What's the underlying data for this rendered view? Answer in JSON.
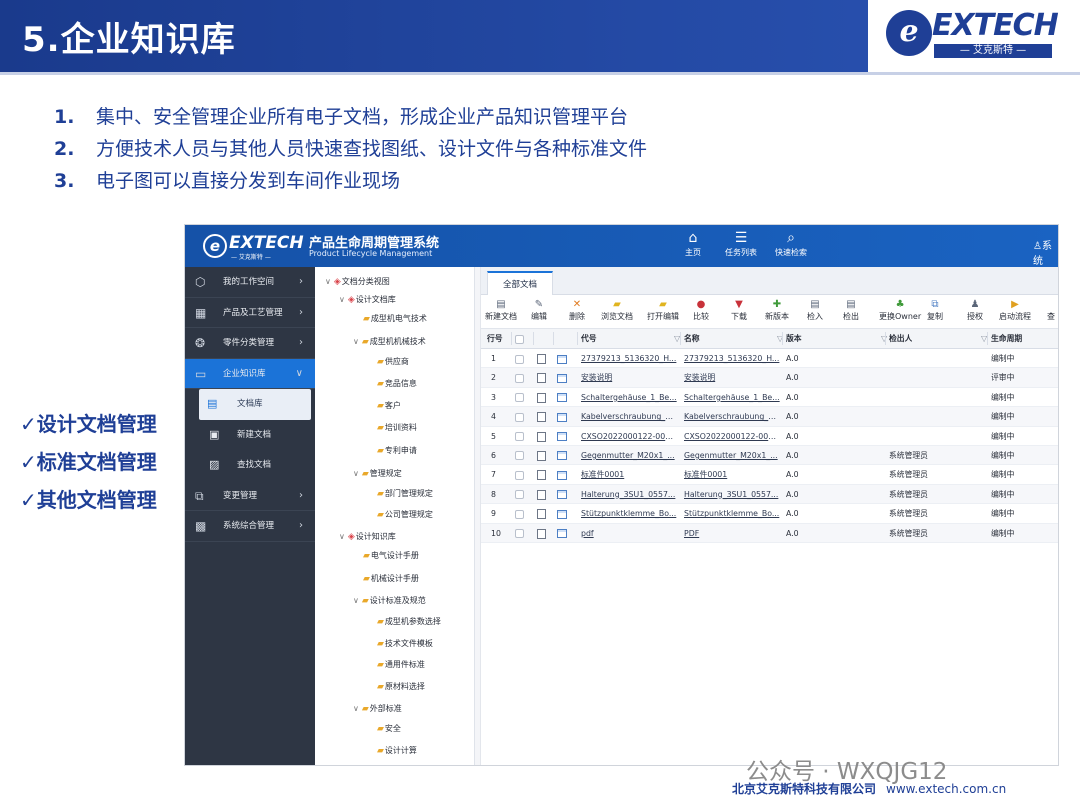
{
  "header": {
    "title": "5.企业知识库"
  },
  "logo": {
    "mark": "e",
    "text": "EXTECH",
    "sub": "— 艾克斯特 —"
  },
  "bullets": [
    {
      "num": "1.",
      "text": "集中、安全管理企业所有电子文档，形成企业产品知识管理平台"
    },
    {
      "num": "2.",
      "text": "方便技术人员与其他人员快速查找图纸、设计文件与各种标准文件"
    },
    {
      "num": "3.",
      "text": "电子图可以直接分发到车间作业现场"
    }
  ],
  "checks": [
    "✓设计文档管理",
    "✓标准文档管理",
    "✓其他文档管理"
  ],
  "app": {
    "logo_mark": "e",
    "logo_text": "EXTECH",
    "logo_sub": "— 艾克斯特 —",
    "title": "产品生命周期管理系统",
    "title_en": "Product Lifecycle Management",
    "nav": [
      {
        "icon": "home-icon",
        "glyph": "⌂",
        "label": "主页"
      },
      {
        "icon": "task-list-icon",
        "glyph": "☰",
        "label": "任务列表"
      },
      {
        "icon": "search-icon",
        "glyph": "⌕",
        "label": "快速检索"
      }
    ],
    "user_label": "系统",
    "sidenav": [
      {
        "icon": "cube-icon",
        "glyph": "⬡",
        "label": "我的工作空间"
      },
      {
        "icon": "grid-icon",
        "glyph": "▦",
        "label": "产品及工艺管理"
      },
      {
        "icon": "gear-parts-icon",
        "glyph": "❂",
        "label": "零件分类管理"
      },
      {
        "icon": "folder-icon",
        "glyph": "▭",
        "label": "企业知识库"
      }
    ],
    "sidenav_sub": [
      {
        "icon": "library-icon",
        "glyph": "▤",
        "label": "文档库"
      },
      {
        "icon": "new-doc-icon",
        "glyph": "▣",
        "label": "新建文档"
      },
      {
        "icon": "find-doc-icon",
        "glyph": "▨",
        "label": "查找文档"
      }
    ],
    "sidenav_bottom": [
      {
        "icon": "change-icon",
        "glyph": "⧉",
        "label": "变更管理"
      },
      {
        "icon": "toolbox-icon",
        "glyph": "▩",
        "label": "系统综合管理"
      }
    ],
    "tree": [
      {
        "level": 0,
        "toggle": "∨",
        "label": "文档分类视图",
        "root": true
      },
      {
        "level": 1,
        "toggle": "∨",
        "label": "设计文档库",
        "root": true
      },
      {
        "level": 2,
        "toggle": "",
        "label": "成型机电气技术"
      },
      {
        "level": 2,
        "toggle": "∨",
        "label": "成型机机械技术"
      },
      {
        "level": 3,
        "toggle": "",
        "label": "供应商"
      },
      {
        "level": 3,
        "toggle": "",
        "label": "竞品信息"
      },
      {
        "level": 3,
        "toggle": "",
        "label": "客户"
      },
      {
        "level": 3,
        "toggle": "",
        "label": "培训资料"
      },
      {
        "level": 3,
        "toggle": "",
        "label": "专利申请"
      },
      {
        "level": 2,
        "toggle": "∨",
        "label": "管理规定"
      },
      {
        "level": 3,
        "toggle": "",
        "label": "部门管理规定"
      },
      {
        "level": 3,
        "toggle": "",
        "label": "公司管理规定"
      },
      {
        "level": 1,
        "toggle": "∨",
        "label": "设计知识库",
        "root": true
      },
      {
        "level": 2,
        "toggle": "",
        "label": "电气设计手册"
      },
      {
        "level": 2,
        "toggle": "",
        "label": "机械设计手册"
      },
      {
        "level": 2,
        "toggle": "∨",
        "label": "设计标准及规范"
      },
      {
        "level": 3,
        "toggle": "",
        "label": "成型机参数选择"
      },
      {
        "level": 3,
        "toggle": "",
        "label": "技术文件模板"
      },
      {
        "level": 3,
        "toggle": "",
        "label": "通用件标准"
      },
      {
        "level": 3,
        "toggle": "",
        "label": "原材料选择"
      },
      {
        "level": 2,
        "toggle": "∨",
        "label": "外部标准"
      },
      {
        "level": 3,
        "toggle": "",
        "label": "安全"
      },
      {
        "level": 3,
        "toggle": "",
        "label": "设计计算"
      }
    ],
    "tab": "全部文档",
    "toolbar": [
      {
        "icon": "new-doc-icon",
        "glyph": "▤",
        "color": "#5a6578",
        "label": "新建文档"
      },
      {
        "icon": "edit-icon",
        "glyph": "✎",
        "color": "#5a6578",
        "label": "编辑"
      },
      {
        "icon": "delete-icon",
        "glyph": "✕",
        "color": "#e07a1f",
        "label": "删除"
      },
      {
        "icon": "browse-doc-icon",
        "glyph": "▰",
        "color": "#e0b41f",
        "label": "浏览文档"
      },
      {
        "icon": "open-edit-icon",
        "glyph": "▰",
        "color": "#e0b41f",
        "label": "打开编辑"
      },
      {
        "icon": "compare-icon",
        "glyph": "●",
        "color": "#c8323a",
        "label": "比较"
      },
      {
        "icon": "download-icon",
        "glyph": "▼",
        "color": "#c8323a",
        "label": "下载"
      },
      {
        "icon": "new-version-icon",
        "glyph": "✚",
        "color": "#3f9a3a",
        "label": "新版本"
      },
      {
        "icon": "checkin-icon",
        "glyph": "▤",
        "color": "#5a6578",
        "label": "检入"
      },
      {
        "icon": "checkout-icon",
        "glyph": "▤",
        "color": "#5a6578",
        "label": "检出"
      },
      {
        "icon": "change-owner-icon",
        "glyph": "♣",
        "color": "#3f9a3a",
        "label": "更换Owner"
      },
      {
        "icon": "copy-icon",
        "glyph": "⧉",
        "color": "#4d7fc4",
        "label": "复制"
      },
      {
        "icon": "grant-icon",
        "glyph": "♟",
        "color": "#5a6578",
        "label": "授权"
      },
      {
        "icon": "start-flow-icon",
        "glyph": "▶",
        "color": "#e0a020",
        "label": "启动流程"
      },
      {
        "icon": "more-icon",
        "glyph": "",
        "color": "#5a6578",
        "label": "查"
      }
    ],
    "columns": [
      "行号",
      "代号",
      "名称",
      "版本",
      "检出人",
      "生命周期"
    ],
    "rows": [
      {
        "no": "1",
        "code": "27379213_5136320_H...",
        "name": "27379213_5136320_H...",
        "ver": "A.0",
        "owner": "",
        "life": "编制中"
      },
      {
        "no": "2",
        "code": "安装说明",
        "name": "安装说明",
        "ver": "A.0",
        "owner": "",
        "life": "评审中"
      },
      {
        "no": "3",
        "code": "Schaltergehäuse_1_Be...",
        "name": "Schaltergehäuse_1_Be...",
        "ver": "A.0",
        "owner": "",
        "life": "编制中"
      },
      {
        "no": "4",
        "code": "Kabelverschraubung_S...",
        "name": "Kabelverschraubung_S...",
        "ver": "A.0",
        "owner": "",
        "life": "编制中"
      },
      {
        "no": "5",
        "code": "CXSO2022000122-000...",
        "name": "CXSO2022000122-000...",
        "ver": "A.0",
        "owner": "",
        "life": "编制中"
      },
      {
        "no": "6",
        "code": "Gegenmutter_M20x1_...",
        "name": "Gegenmutter_M20x1_...",
        "ver": "A.0",
        "owner": "系统管理员",
        "life": "编制中"
      },
      {
        "no": "7",
        "code": "标准件0001",
        "name": "标准件0001",
        "ver": "A.0",
        "owner": "系统管理员",
        "life": "编制中"
      },
      {
        "no": "8",
        "code": "Halterung_3SU1_0557...",
        "name": "Halterung_3SU1_0557...",
        "ver": "A.0",
        "owner": "系统管理员",
        "life": "编制中"
      },
      {
        "no": "9",
        "code": "Stützpunktklemme_Bo...",
        "name": "Stützpunktklemme_Bo...",
        "ver": "A.0",
        "owner": "系统管理员",
        "life": "编制中"
      },
      {
        "no": "10",
        "code": "pdf",
        "name": "PDF",
        "ver": "A.0",
        "owner": "系统管理员",
        "life": "编制中"
      }
    ]
  },
  "watermark": "公众号 · WXQJG12",
  "footer": {
    "company": "北京艾克斯特科技有限公司",
    "url": "www.extech.com.cn"
  }
}
